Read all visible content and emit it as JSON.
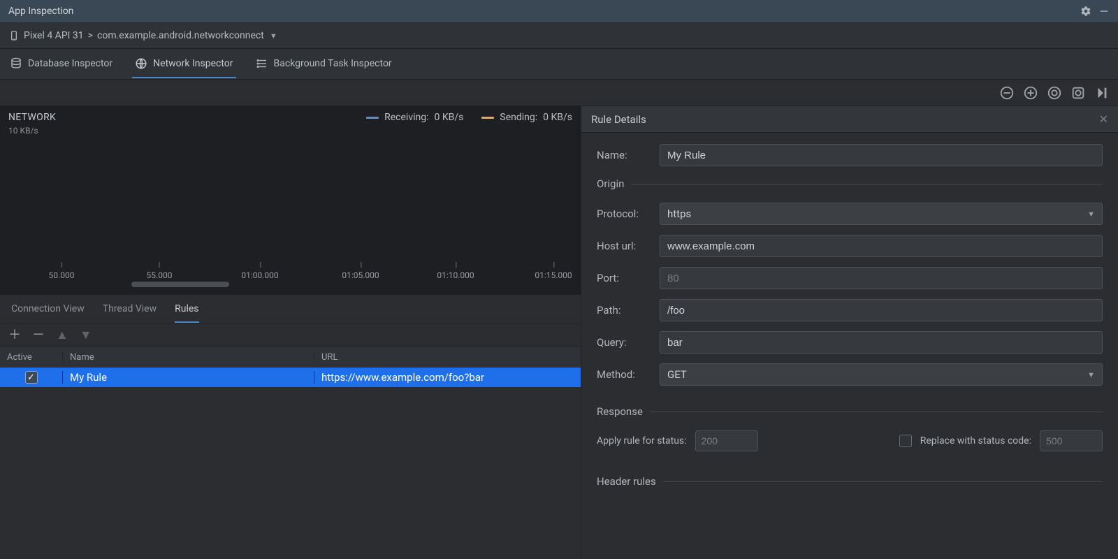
{
  "titlebar": {
    "title": "App Inspection"
  },
  "breadcrumb": {
    "device": "Pixel 4 API 31",
    "sep": " > ",
    "app": "com.example.android.networkconnect"
  },
  "inspectorTabs": {
    "database": "Database Inspector",
    "network": "Network Inspector",
    "background": "Background Task Inspector"
  },
  "network": {
    "title": "NETWORK",
    "scale": "10 KB/s",
    "legend": {
      "receiving_label": "Receiving:",
      "receiving_value": "0 KB/s",
      "receiving_color": "#5a8ed6",
      "sending_label": "Sending:",
      "sending_value": "0 KB/s",
      "sending_color": "#f0a84a"
    },
    "timeline_ticks": [
      "50.000",
      "55.000",
      "01:00.000",
      "01:05.000",
      "01:10.000",
      "01:15.000"
    ]
  },
  "lowerTabs": {
    "connection": "Connection View",
    "thread": "Thread View",
    "rules": "Rules"
  },
  "rulesTable": {
    "headers": {
      "active": "Active",
      "name": "Name",
      "url": "URL"
    },
    "rows": [
      {
        "active": true,
        "name": "My Rule",
        "url": "https://www.example.com/foo?bar"
      }
    ]
  },
  "details": {
    "title": "Rule Details",
    "name_label": "Name:",
    "name_value": "My Rule",
    "origin_section": "Origin",
    "protocol_label": "Protocol:",
    "protocol_value": "https",
    "host_label": "Host url:",
    "host_value": "www.example.com",
    "port_label": "Port:",
    "port_placeholder": "80",
    "path_label": "Path:",
    "path_value": "/foo",
    "query_label": "Query:",
    "query_value": "bar",
    "method_label": "Method:",
    "method_value": "GET",
    "response_section": "Response",
    "apply_status_label": "Apply rule for status:",
    "apply_status_placeholder": "200",
    "replace_status_label": "Replace with status code:",
    "replace_status_placeholder": "500",
    "header_rules_section": "Header rules"
  }
}
